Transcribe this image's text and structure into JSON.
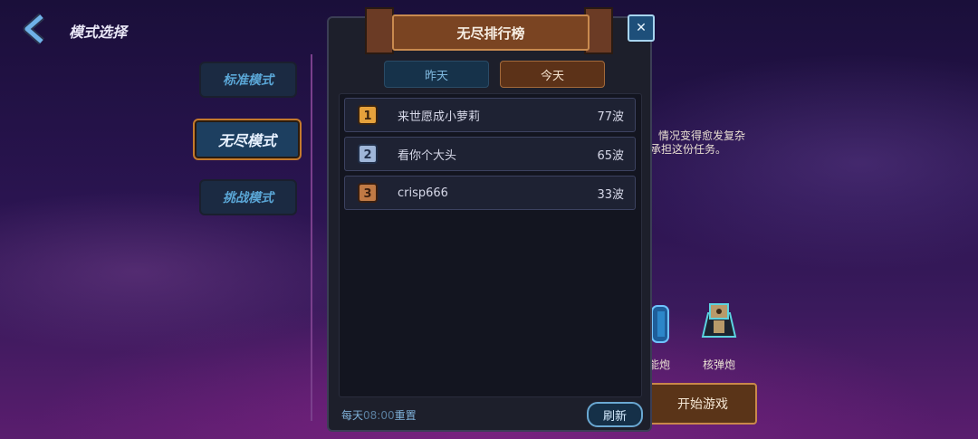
{
  "header": {
    "title": "模式选择"
  },
  "modes": [
    {
      "label": "标准模式",
      "selected": false
    },
    {
      "label": "无尽模式",
      "selected": true
    },
    {
      "label": "挑战模式",
      "selected": false
    }
  ],
  "background": {
    "description_lines": [
      "情况变得愈发复杂",
      "承担这份任务。"
    ],
    "weapons": [
      {
        "label": "能炮",
        "icon": "cannon-icon"
      },
      {
        "label": "核弹炮",
        "icon": "nuke-cannon-icon"
      }
    ],
    "start_button": "开始游戏"
  },
  "leaderboard": {
    "title": "无尽排行榜",
    "close_icon": "close-icon",
    "tabs": [
      {
        "label": "昨天",
        "active": false
      },
      {
        "label": "今天",
        "active": true
      }
    ],
    "rows": [
      {
        "rank": "1",
        "name": "来世愿成小萝莉",
        "score": "77波"
      },
      {
        "rank": "2",
        "name": "看你个大头",
        "score": "65波"
      },
      {
        "rank": "3",
        "name": "crisp666",
        "score": "33波"
      }
    ],
    "reset_time_prefix": "每天",
    "reset_time": "08:00",
    "reset_time_suffix": "重置",
    "refresh_button": "刷新"
  },
  "colors": {
    "rank1": "#e6a23c",
    "rank2": "#9fb6d8",
    "rank3": "#c07a45"
  }
}
